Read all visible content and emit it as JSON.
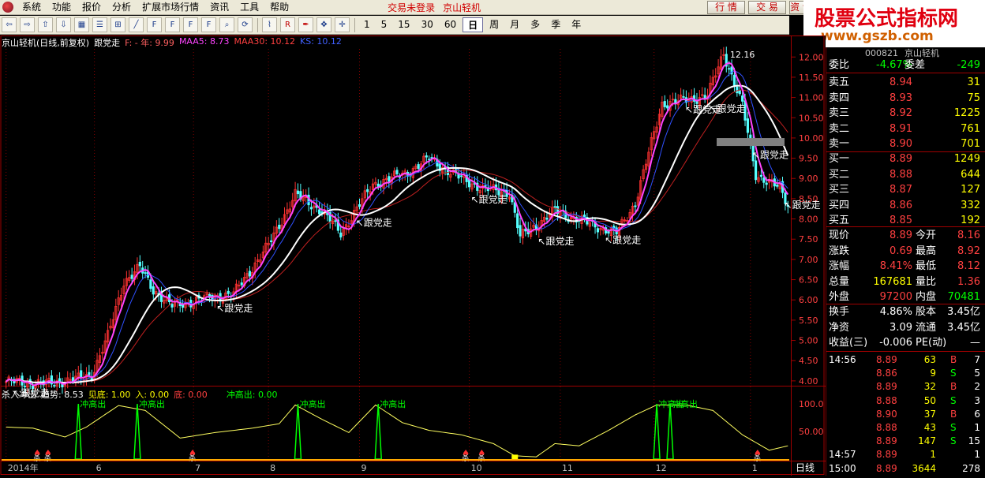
{
  "menu": {
    "items": [
      "系统",
      "功能",
      "报价",
      "分析",
      "扩展市场行情",
      "资讯",
      "工具",
      "帮助"
    ],
    "status": "交易未登录",
    "stock_name": "京山轻机",
    "buttons": [
      "行 情",
      "交 易",
      "资 讯"
    ]
  },
  "watermark": {
    "line1": "股票公式指标网",
    "line2": "www.gszb.com"
  },
  "toolbar": {
    "periods": [
      "1",
      "5",
      "15",
      "30",
      "60",
      "日",
      "周",
      "月",
      "多",
      "季",
      "年"
    ],
    "active_period": "日"
  },
  "legend": {
    "title": "京山轻机(日线,前复权)",
    "indicator": "跟党走",
    "f_label": "F: - 年: 9.99",
    "maa5": "MAA5: 8.73",
    "maa30": "MAA30: 10.12",
    "ks": "KS: 10.12"
  },
  "sub_legend": {
    "name": "杀入冲出",
    "trend": "趋势: 8.53",
    "jiandi": "见底: 1.00",
    "ru": "入: 0.00",
    "di": "底: 0.00",
    "chong": "冲高出: 0.00"
  },
  "colors": {
    "up": "#ff3232",
    "down": "#54ffff",
    "maa5": "#ff44ff",
    "maa30": "#ffffff",
    "ma_red": "#c02020",
    "ks": "#3050ff",
    "yellow": "#ffff00",
    "green": "#00ff00"
  },
  "chart_data": {
    "type": "candlestick",
    "price_ticks": [
      "12.00",
      "11.50",
      "11.00",
      "10.50",
      "10.00",
      "9.50",
      "9.00",
      "8.50",
      "8.00",
      "7.50",
      "7.00",
      "6.50",
      "6.00",
      "5.50",
      "5.00",
      "4.50",
      "4.00"
    ],
    "price_range": [
      3.9,
      12.2
    ],
    "sub_ticks": [
      "100.0",
      "50.00"
    ],
    "sub_range": [
      0,
      110
    ],
    "month_labels": [
      "2014年",
      "6",
      "7",
      "8",
      "9",
      "10",
      "11",
      "12",
      "1"
    ],
    "month_index": [
      0,
      33,
      70,
      98,
      132,
      173,
      207,
      242,
      278
    ],
    "max_label": "12.16",
    "annotation": "跟党走",
    "annotation_index": [
      2,
      78,
      130,
      173,
      198,
      223,
      253,
      262,
      278,
      290
    ],
    "kline_seed": [
      [
        0,
        3.98
      ],
      [
        15,
        3.93
      ],
      [
        27,
        4.05
      ],
      [
        32,
        4.15
      ],
      [
        38,
        5.1
      ],
      [
        44,
        6.45
      ],
      [
        50,
        6.8
      ],
      [
        55,
        6.25
      ],
      [
        62,
        5.85
      ],
      [
        75,
        6.05
      ],
      [
        85,
        6.15
      ],
      [
        98,
        7.35
      ],
      [
        108,
        8.6
      ],
      [
        118,
        8.2
      ],
      [
        125,
        7.65
      ],
      [
        137,
        8.85
      ],
      [
        150,
        9.15
      ],
      [
        158,
        9.5
      ],
      [
        167,
        9.1
      ],
      [
        178,
        8.75
      ],
      [
        188,
        8.65
      ],
      [
        192,
        7.55
      ],
      [
        205,
        8.2
      ],
      [
        215,
        7.95
      ],
      [
        228,
        7.65
      ],
      [
        235,
        8.4
      ],
      [
        245,
        10.85
      ],
      [
        255,
        10.95
      ],
      [
        262,
        11.05
      ],
      [
        268,
        12.1
      ],
      [
        275,
        10.8
      ],
      [
        280,
        9.1
      ],
      [
        289,
        8.75
      ],
      [
        292,
        8.35
      ]
    ],
    "n": 293,
    "osc_seed": [
      [
        0,
        58
      ],
      [
        10,
        56
      ],
      [
        22,
        40
      ],
      [
        30,
        58
      ],
      [
        42,
        97
      ],
      [
        52,
        88
      ],
      [
        65,
        38
      ],
      [
        78,
        48
      ],
      [
        92,
        56
      ],
      [
        102,
        64
      ],
      [
        108,
        98
      ],
      [
        118,
        72
      ],
      [
        128,
        48
      ],
      [
        138,
        98
      ],
      [
        148,
        66
      ],
      [
        158,
        52
      ],
      [
        170,
        44
      ],
      [
        182,
        28
      ],
      [
        190,
        6
      ],
      [
        198,
        4
      ],
      [
        205,
        28
      ],
      [
        214,
        24
      ],
      [
        225,
        52
      ],
      [
        235,
        80
      ],
      [
        243,
        98
      ],
      [
        255,
        97
      ],
      [
        264,
        88
      ],
      [
        275,
        44
      ],
      [
        285,
        16
      ],
      [
        292,
        24
      ]
    ],
    "chong_index": [
      27,
      49,
      109,
      139,
      243,
      248
    ],
    "buy_index": [
      12,
      16,
      70,
      172,
      178,
      281
    ],
    "last_close": "8.89"
  },
  "quote": {
    "code": "000821",
    "name": "京山轻机",
    "wei": [
      {
        "l": "委比",
        "v": "-4.67%",
        "l2": "委差",
        "v2": "-249"
      }
    ],
    "sell": [
      {
        "l": "卖五",
        "p": "8.94",
        "q": "31"
      },
      {
        "l": "卖四",
        "p": "8.93",
        "q": "75"
      },
      {
        "l": "卖三",
        "p": "8.92",
        "q": "1225"
      },
      {
        "l": "卖二",
        "p": "8.91",
        "q": "761"
      },
      {
        "l": "卖一",
        "p": "8.90",
        "q": "701"
      }
    ],
    "buy": [
      {
        "l": "买一",
        "p": "8.89",
        "q": "1249"
      },
      {
        "l": "买二",
        "p": "8.88",
        "q": "644"
      },
      {
        "l": "买三",
        "p": "8.87",
        "q": "127"
      },
      {
        "l": "买四",
        "p": "8.86",
        "q": "332"
      },
      {
        "l": "买五",
        "p": "8.85",
        "q": "192"
      }
    ],
    "stats": [
      {
        "l": "现价",
        "v": "8.89",
        "l2": "今开",
        "v2": "8.16"
      },
      {
        "l": "涨跌",
        "v": "0.69",
        "l2": "最高",
        "v2": "8.92"
      },
      {
        "l": "涨幅",
        "v": "8.41%",
        "l2": "最低",
        "v2": "8.12"
      },
      {
        "l": "总量",
        "v": "167681",
        "l2": "量比",
        "v2": "1.36"
      },
      {
        "l": "外盘",
        "v": "97200",
        "l2": "内盘",
        "v2": "70481"
      }
    ],
    "stats2": [
      {
        "l": "换手",
        "v": "4.86%",
        "l2": "股本",
        "v2": "3.45亿"
      },
      {
        "l": "净资",
        "v": "3.09",
        "l2": "流通",
        "v2": "3.45亿"
      },
      {
        "l": "收益(三)",
        "v": "-0.006",
        "l2": "PE(动)",
        "v2": "—"
      }
    ],
    "ticks": [
      {
        "t": "14:56",
        "p": "8.89",
        "q": "63",
        "s": "B"
      },
      {
        "t": "",
        "p": "8.86",
        "q": "9",
        "s": "S"
      },
      {
        "t": "",
        "p": "8.89",
        "q": "32",
        "s": "B"
      },
      {
        "t": "",
        "p": "8.88",
        "q": "50",
        "s": "S"
      },
      {
        "t": "",
        "p": "8.90",
        "q": "37",
        "s": "B"
      },
      {
        "t": "",
        "p": "8.88",
        "q": "43",
        "s": "S"
      },
      {
        "t": "",
        "p": "8.89",
        "q": "147",
        "s": "S"
      },
      {
        "t": "14:57",
        "p": "8.89",
        "q": "1",
        "s": ""
      },
      {
        "t": "15:00",
        "p": "8.89",
        "q": "3644",
        "s": ""
      }
    ],
    "tick_side_nums": [
      "7",
      "5",
      "2",
      "3",
      "6",
      "1",
      "15",
      "1",
      "278"
    ],
    "tab": "日线"
  }
}
